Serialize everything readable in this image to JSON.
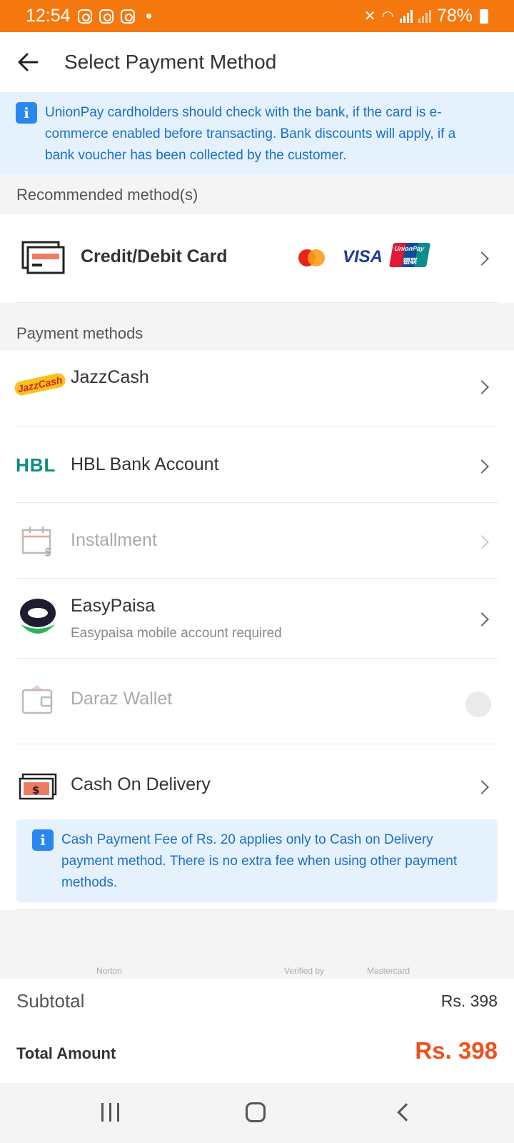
{
  "status_bar": {
    "time": "12:54",
    "battery": "78%"
  },
  "header": {
    "title": "Select Payment Method"
  },
  "top_notice": "UnionPay cardholders should check with the bank, if the card is e-commerce enabled before transacting. Bank discounts will apply, if a bank voucher has been collected by the customer.",
  "recommended": {
    "heading": "Recommended method(s)",
    "card": {
      "label": "Credit/Debit Card",
      "brands": [
        "VISA",
        "UnionPay",
        "银联"
      ]
    }
  },
  "payment_methods": {
    "heading": "Payment methods",
    "items": [
      {
        "label": "JazzCash",
        "logo_text": "JazzCash"
      },
      {
        "label": "HBL Bank Account",
        "logo_text": "HBL"
      },
      {
        "label": "Installment"
      },
      {
        "label": "EasyPaisa",
        "sub": "Easypaisa mobile account required"
      },
      {
        "label": "Daraz Wallet"
      },
      {
        "label": "Cash On Delivery"
      }
    ]
  },
  "cod_notice": "Cash Payment Fee of Rs. 20 applies only to Cash on Delivery payment method. There is no extra fee when using other payment methods.",
  "verified_logos": [
    "Norton",
    "Verified by",
    "Mastercard"
  ],
  "summary": {
    "subtotal_label": "Subtotal",
    "subtotal_value": "Rs. 398",
    "total_label": "Total Amount",
    "total_value": "Rs. 398"
  },
  "colors": {
    "brand_orange": "#f5780f",
    "total_red": "#f2501b",
    "info_blue": "#1a6fc9",
    "notice_bg": "#e5f1fd"
  }
}
